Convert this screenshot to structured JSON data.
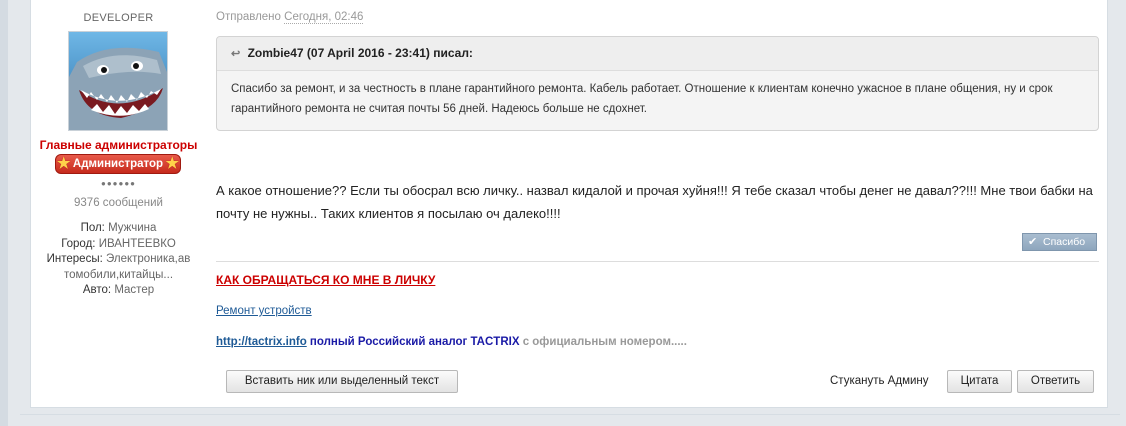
{
  "user": {
    "role_top": "DEVELOPER",
    "avatar_icon": "shark-avatar",
    "group_name": "Главные администраторы",
    "badge": "Администратор",
    "pips": "●●●●●●",
    "message_count": "9376 сообщений",
    "profile": [
      {
        "label": "Пол:",
        "value": "Мужчина"
      },
      {
        "label": "Город:",
        "value": "ИВАНТЕЕВКО"
      },
      {
        "label": "Интересы:",
        "value": "Электроника,автомобили,китайцы..."
      },
      {
        "label": "Авто:",
        "value": "Мастер"
      }
    ]
  },
  "post": {
    "posted_prefix": "Отправлено",
    "posted_date": "Сегодня, 02:46",
    "quote_author": "Zombie47 (07 April 2016 - 23:41) писал:",
    "quote_text": "Спасибо за ремонт, и за честность в плане гарантийного ремонта. Кабель работает. Отношение к клиентам конечно ужасное в плане общения, ну и срок гарантийного ремонта не считая почты 56 дней. Надеюсь больше не сдохнет.",
    "text": "А какое отношение?? Если ты обосрал всю личку.. назвал кидалой и прочая хуйня!!! Я тебе сказал чтобы денег не давал??!!! Мне твои бабки на почту не нужны.. Таких клиентов я посылаю оч далеко!!!!",
    "thanks_label": "Спасибо"
  },
  "signature": {
    "line1": "КАК ОБРАЩАТЬСЯ КО МНЕ В ЛИЧКУ",
    "line2": "Ремонт устройств",
    "line3_link": "http://tactrix.info",
    "line3_blue": " полный Российский аналог TACTRIX",
    "line3_grey": " с официальным номером....."
  },
  "actions": {
    "insert_nick": "Вставить ник или выделенный текст",
    "report_admin": "Стукануть Админу",
    "quote": "Цитата",
    "reply": "Ответить"
  },
  "colors": {
    "group": "#cc0000",
    "badge": "#d63a2b",
    "link": "#1e5a96"
  }
}
